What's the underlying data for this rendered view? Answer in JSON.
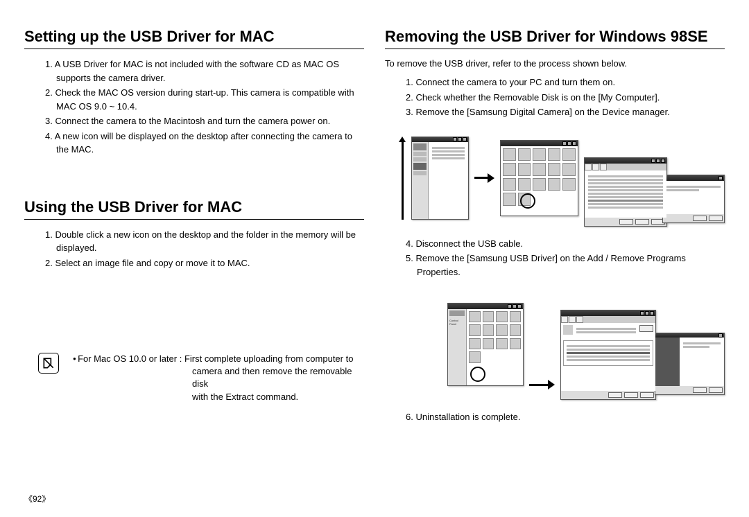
{
  "page_number": "《92》",
  "left": {
    "section1": {
      "heading": "Setting up the USB Driver for MAC",
      "items": [
        "1. A USB Driver for MAC is not included with the software CD as MAC OS supports the camera driver.",
        "2. Check the MAC OS version during start-up. This camera is compatible with MAC OS 9.0 ~ 10.4.",
        "3. Connect the camera to the Macintosh and turn the camera power on.",
        "4. A new icon will be displayed on the desktop after connecting the camera to the MAC."
      ]
    },
    "section2": {
      "heading": "Using the USB Driver for MAC",
      "items": [
        "1. Double click a new icon on the desktop and the folder in the memory will be displayed.",
        "2. Select an image file and copy or move it to MAC."
      ]
    },
    "note": {
      "bullet": "For Mac OS 10.0 or later : First complete uploading from computer to",
      "cont1": "camera and then remove the removable disk",
      "cont2": "with the Extract command."
    }
  },
  "right": {
    "heading": "Removing the USB Driver for Windows 98SE",
    "intro": "To remove the USB driver, refer to the process shown below.",
    "items_a": [
      "1. Connect the camera to your PC and turn them on.",
      "2. Check whether the Removable Disk is on the [My Computer].",
      "3. Remove the [Samsung Digital Camera] on the Device manager."
    ],
    "items_b": [
      "4. Disconnect the USB cable.",
      "5. Remove the [Samsung USB Driver] on the Add / Remove Programs Properties."
    ],
    "items_c": [
      "6. Uninstallation is complete."
    ]
  }
}
